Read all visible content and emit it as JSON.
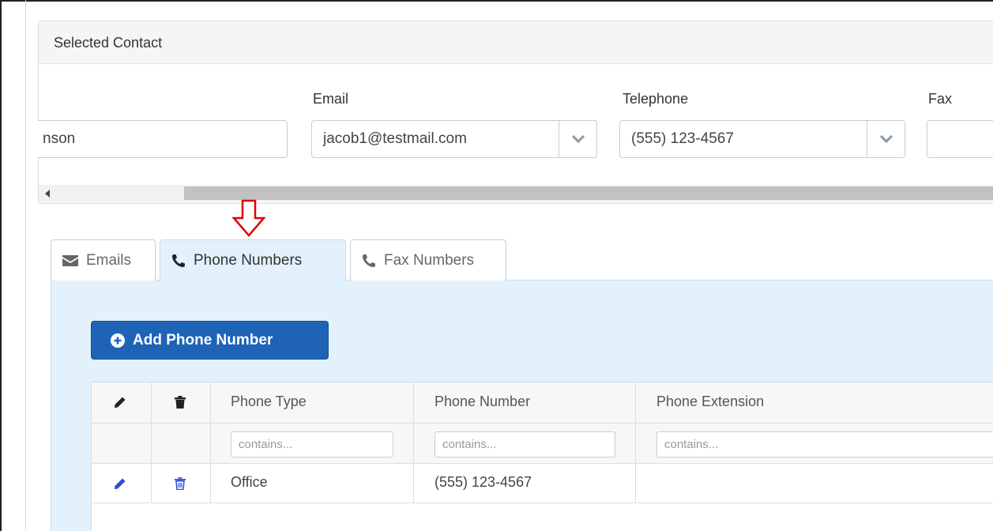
{
  "panel": {
    "heading": "Selected Contact",
    "name_value": "nson",
    "email_label": "Email",
    "email_value": "jacob1@testmail.com",
    "telephone_label": "Telephone",
    "telephone_value": "(555) 123-4567",
    "fax_label": "Fax",
    "fax_value": ""
  },
  "tabs": [
    {
      "label": "Emails",
      "icon": "envelope-icon",
      "active": false
    },
    {
      "label": "Phone Numbers",
      "icon": "phone-icon",
      "active": true
    },
    {
      "label": "Fax Numbers",
      "icon": "phone-icon",
      "active": false
    }
  ],
  "add_button": {
    "label": "Add Phone Number",
    "icon": "plus-circle-icon"
  },
  "grid": {
    "columns": [
      "Phone Type",
      "Phone Number",
      "Phone Extension"
    ],
    "filter_placeholder": "contains...",
    "rows": [
      {
        "phone_type": "Office",
        "phone_number": "(555) 123-4567",
        "phone_extension": ""
      }
    ]
  },
  "colors": {
    "tab_content_bg": "#e3f1fd",
    "primary_button": "#1e63b6",
    "annotation_arrow": "#e00000",
    "row_icon": "#2a4dd6"
  }
}
